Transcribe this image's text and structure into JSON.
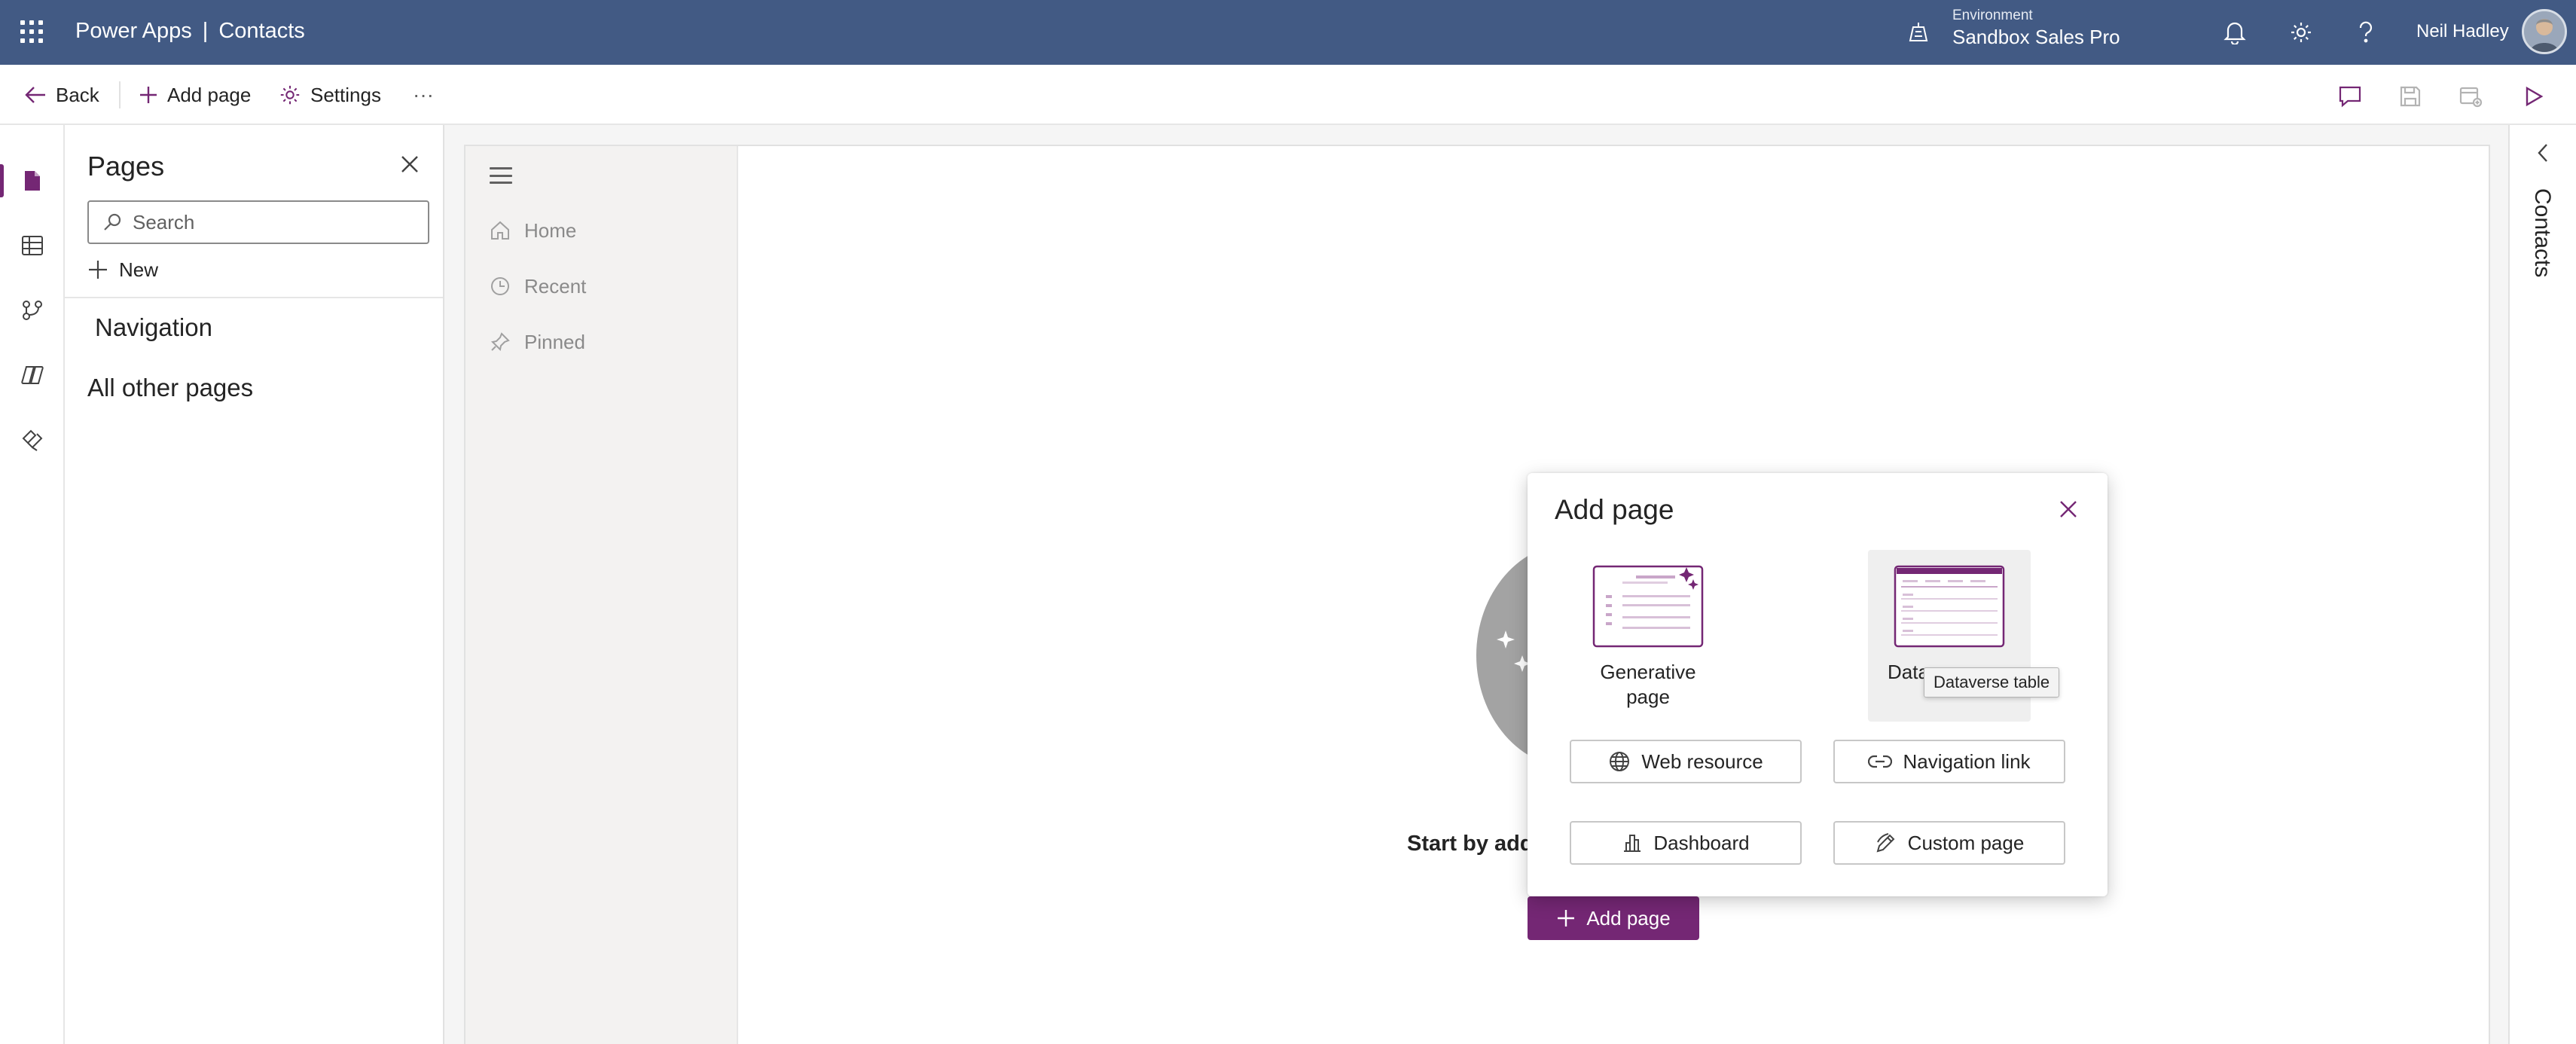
{
  "header": {
    "app_name": "Power Apps",
    "separator": "|",
    "app_title": "Contacts",
    "environment_label": "Environment",
    "environment_name": "Sandbox Sales Pro",
    "user_name": "Neil Hadley"
  },
  "commandbar": {
    "back_label": "Back",
    "add_page_label": "Add page",
    "settings_label": "Settings",
    "more_label": "···"
  },
  "pages_panel": {
    "title": "Pages",
    "search_placeholder": "Search",
    "new_label": "New",
    "navigation_section": "Navigation",
    "other_pages_section": "All other pages"
  },
  "preview": {
    "sitemap_items": [
      {
        "label": "Home",
        "icon": "home-icon"
      },
      {
        "label": "Recent",
        "icon": "clock-icon"
      },
      {
        "label": "Pinned",
        "icon": "pin-icon"
      }
    ],
    "empty_text": "Start by add",
    "add_page_button": "Add page"
  },
  "dialog": {
    "title": "Add page",
    "tiles": [
      {
        "label": "Generative page"
      },
      {
        "label": "Datav"
      }
    ],
    "tooltip": "Dataverse table",
    "options": [
      {
        "label": "Web resource",
        "icon": "globe-icon"
      },
      {
        "label": "Navigation link",
        "icon": "link-icon"
      },
      {
        "label": "Dashboard",
        "icon": "dashboard-icon"
      },
      {
        "label": "Custom page",
        "icon": "pen-icon"
      }
    ]
  },
  "right_pane": {
    "title": "Contacts"
  },
  "colors": {
    "header_bg": "#425a84",
    "accent": "#742774",
    "tile_hover": "#efefef"
  }
}
